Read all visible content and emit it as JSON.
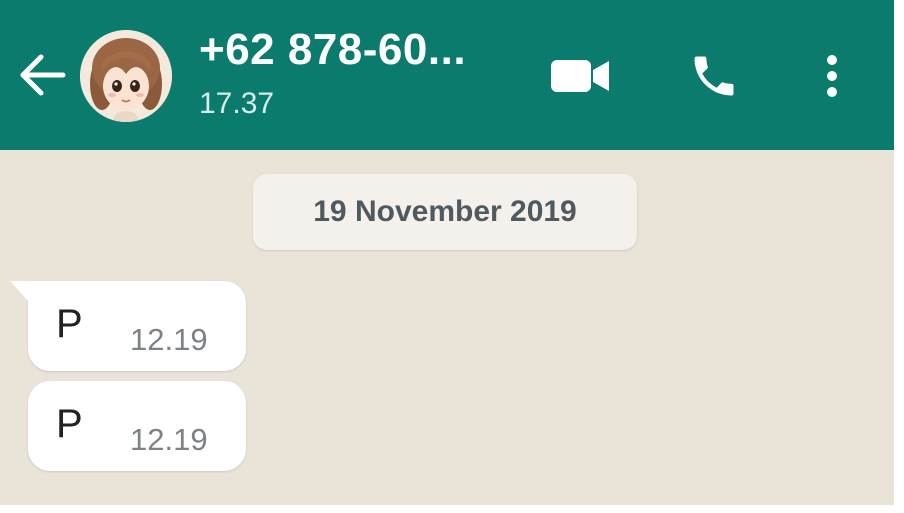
{
  "colors": {
    "header_bg": "#0b7b6e",
    "chat_bg": "#e9e3d8",
    "bubble_bg": "#ffffff",
    "date_pill_bg": "#f4f1ec"
  },
  "header": {
    "contact_name": "+62 878-60...",
    "contact_status": "17.37",
    "icons": [
      "back-arrow-icon",
      "avatar",
      "video-camera-icon",
      "phone-icon",
      "more-vertical-icon"
    ]
  },
  "chat": {
    "date_divider": "19 November 2019",
    "messages": [
      {
        "text": "P",
        "time": "12.19"
      },
      {
        "text": "P",
        "time": "12.19"
      }
    ]
  }
}
